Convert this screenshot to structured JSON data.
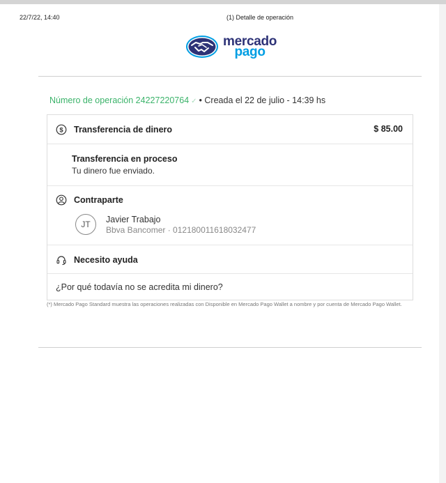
{
  "print_header": {
    "date": "22/7/22, 14:40",
    "title": "(1) Detalle de operación"
  },
  "logo": {
    "line1": "mercado",
    "line2": "pago",
    "colors": {
      "navy": "#2d3277",
      "blue": "#009ee3",
      "yellow": "#ffe600"
    }
  },
  "operation": {
    "number_label": "Número de operación 24227220764",
    "check": "✓",
    "created": "• Creada el 22 de julio - 14:39 hs"
  },
  "transfer": {
    "icon": "dollar-circle-icon",
    "title": "Transferencia de dinero",
    "amount": "$ 85.00"
  },
  "status": {
    "title": "Transferencia en proceso",
    "subtitle": "Tu dinero fue enviado."
  },
  "counterpart": {
    "icon": "user-circle-icon",
    "title": "Contraparte",
    "initials": "JT",
    "name": "Javier Trabajo",
    "bank": "Bbva Bancomer · 012180011618032477"
  },
  "help": {
    "icon": "headset-icon",
    "title": "Necesito ayuda",
    "question": "¿Por qué todavía no se acredita mi dinero?"
  },
  "footnote": "(*) Mercado Pago Standard muestra las operaciones realizadas con Disponible en Mercado Pago Wallet a nombre y por cuenta de Mercado Pago Wallet.",
  "accent_color": "#3bb36a"
}
